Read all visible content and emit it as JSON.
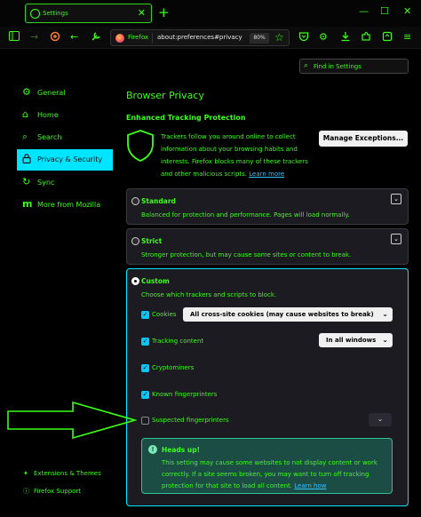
{
  "tab": {
    "title": "Settings",
    "close": "✕"
  },
  "newtab": "+",
  "window": {
    "minimize": "—",
    "maximize": "☐",
    "close": "✕"
  },
  "urlbar": {
    "identity": "Firefox",
    "address": "about:preferences#privacy",
    "zoom": "80%"
  },
  "search": {
    "placeholder": "Find in Settings"
  },
  "sidebar": {
    "items": [
      {
        "label": "General",
        "icon": "gear-icon",
        "glyph": "⚙"
      },
      {
        "label": "Home",
        "icon": "home-icon",
        "glyph": "⌂"
      },
      {
        "label": "Search",
        "icon": "search-icon",
        "glyph": "⌕"
      },
      {
        "label": "Privacy & Security",
        "icon": "lock-icon",
        "glyph": "🔒"
      },
      {
        "label": "Sync",
        "icon": "sync-icon",
        "glyph": "↻"
      },
      {
        "label": "More from Mozilla",
        "icon": "mozilla-icon",
        "glyph": "m"
      }
    ],
    "footer": [
      {
        "label": "Extensions & Themes",
        "icon": "puzzle-icon"
      },
      {
        "label": "Firefox Support",
        "icon": "help-icon"
      }
    ]
  },
  "main": {
    "title": "Browser Privacy",
    "subtitle": "Enhanced Tracking Protection",
    "description": "Trackers follow you around online to collect information about your browsing habits and interests. Firefox blocks many of these trackers and other malicious scripts.",
    "learn_more": "Learn more",
    "exceptions_button": "Manage Exceptions...",
    "standard": {
      "title": "Standard",
      "description": "Balanced for protection and performance. Pages will load normally."
    },
    "strict": {
      "title": "Strict",
      "description": "Stronger protection, but may cause some sites or content to break."
    },
    "custom": {
      "title": "Custom",
      "description": "Choose which trackers and scripts to block.",
      "options": [
        {
          "label": "Cookies",
          "checked": true,
          "dropdown": "All cross-site cookies (may cause websites to break)"
        },
        {
          "label": "Tracking content",
          "checked": true,
          "dropdown": "In all windows"
        },
        {
          "label": "Cryptominers",
          "checked": true
        },
        {
          "label": "Known fingerprinters",
          "checked": true
        },
        {
          "label": "Suspected fingerprinters",
          "checked": false
        }
      ],
      "headsup": {
        "title": "Heads up!",
        "text": "This setting may cause some websites to not display content or work correctly. If a site seems broken, you may want to turn off tracking protection for that site to load all content.",
        "link": "Learn how"
      }
    }
  },
  "colors": {
    "accent": "#39ff14",
    "active": "#00e5ff",
    "background": "#000000",
    "card": "#1c1b22"
  }
}
